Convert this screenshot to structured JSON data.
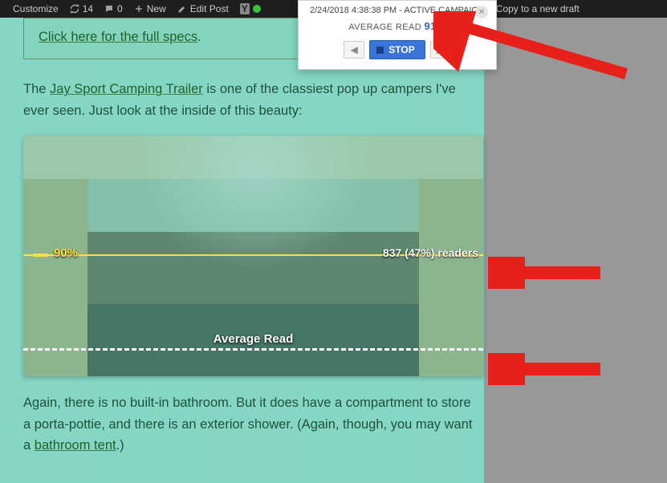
{
  "adminBar": {
    "customize": "Customize",
    "updatesCount": "14",
    "commentsCount": "0",
    "new": "New",
    "editPost": "Edit Post",
    "copyDraft": "Copy to a new draft"
  },
  "popup": {
    "timestampLine": "2/24/2018 4:38:38 PM - ACTIVE CAMPAIGN",
    "avgReadLabel": "AVERAGE READ",
    "avgReadValue": "91%",
    "stopLabel": "STOP"
  },
  "content": {
    "specsLink": "Click here for the full specs",
    "specsPeriod": ".",
    "para1_pre": "The ",
    "para1_link": "Jay Sport Camping Trailer",
    "para1_post": " is one of the classiest pop up campers I've ever seen. Just look at the inside of this beauty:",
    "scanPercent": "90%",
    "readersLabel": "837 (47%) readers",
    "avgReadOverlay": "Average Read",
    "para2_a": "Again, there is no built-in bathroom. But it does have a compartment to store a porta-pottie, and there is an exterior shower. (Again, though, you may want a ",
    "para2_link": "bathroom tent",
    "para2_b": ".)"
  },
  "colors": {
    "arrow": "#e8201a"
  }
}
